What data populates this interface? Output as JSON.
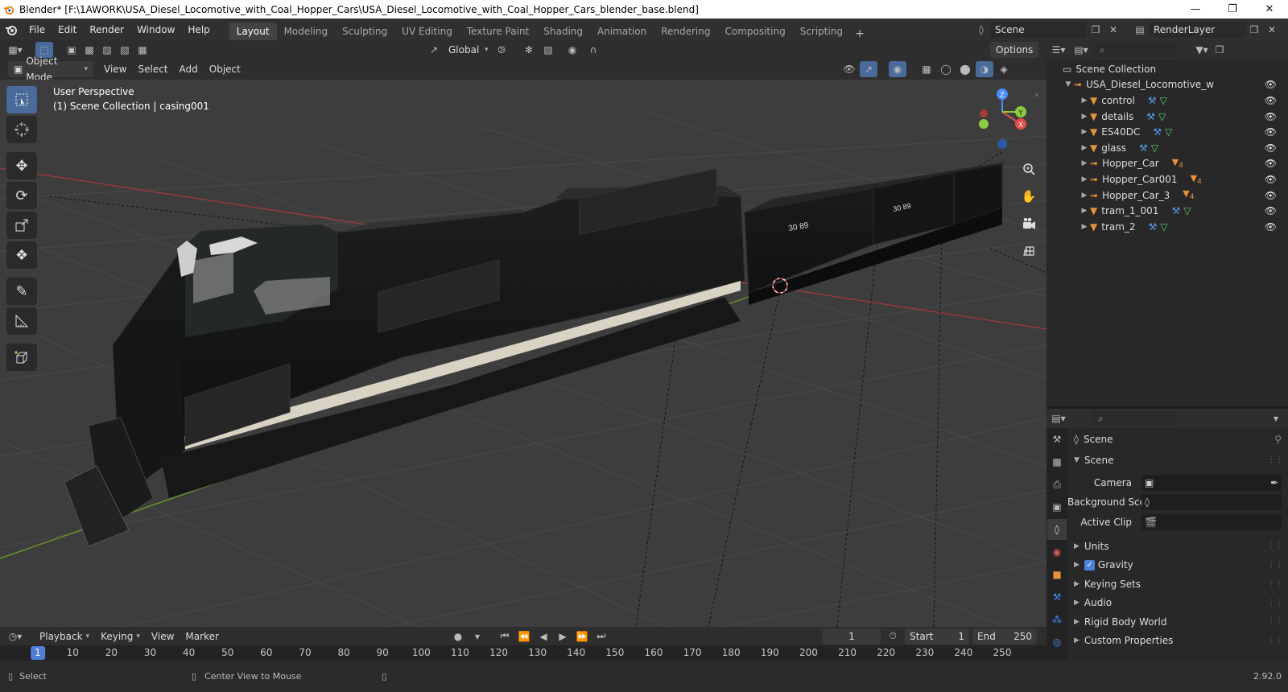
{
  "window": {
    "title": "Blender* [F:\\1AWORK\\USA_Diesel_Locomotive_with_Coal_Hopper_Cars\\USA_Diesel_Locomotive_with_Coal_Hopper_Cars_blender_base.blend]"
  },
  "menu": {
    "file": "File",
    "edit": "Edit",
    "render": "Render",
    "window": "Window",
    "help": "Help"
  },
  "workspaces": [
    "Layout",
    "Modeling",
    "Sculpting",
    "UV Editing",
    "Texture Paint",
    "Shading",
    "Animation",
    "Rendering",
    "Compositing",
    "Scripting"
  ],
  "active_workspace": "Layout",
  "scene_selector": {
    "value": "Scene"
  },
  "render_layer": {
    "value": "RenderLayer"
  },
  "viewport_header": {
    "transform_orientation": "Global",
    "options_label": "Options",
    "mode": "Object Mode",
    "view": "View",
    "select": "Select",
    "add": "Add",
    "object": "Object"
  },
  "viewport": {
    "perspective_label": "User Perspective",
    "collection_label": "(1) Scene Collection | casing001",
    "gizmo": {
      "x": "X",
      "y": "Y",
      "z": "Z"
    },
    "car_number": "30 89",
    "car_number_2": "30 89"
  },
  "outliner": {
    "root": "Scene Collection",
    "collection": "USA_Diesel_Locomotive_with_C",
    "items": [
      {
        "name": "control",
        "icon": "mesh"
      },
      {
        "name": "details",
        "icon": "mesh"
      },
      {
        "name": "ES40DC",
        "icon": "mesh"
      },
      {
        "name": "glass",
        "icon": "mesh"
      },
      {
        "name": "Hopper_Car",
        "icon": "empty",
        "badge": "4"
      },
      {
        "name": "Hopper_Car001",
        "icon": "empty",
        "badge": "4"
      },
      {
        "name": "Hopper_Car_3",
        "icon": "empty",
        "badge": "4"
      },
      {
        "name": "tram_1_001",
        "icon": "mesh"
      },
      {
        "name": "tram_2",
        "icon": "mesh"
      }
    ]
  },
  "properties": {
    "context": "Scene",
    "panel": "Scene",
    "camera_label": "Camera",
    "background_label": "Background Sce...",
    "active_clip_label": "Active Clip",
    "sections": [
      "Units",
      "Gravity",
      "Keying Sets",
      "Audio",
      "Rigid Body World",
      "Custom Properties"
    ],
    "gravity_checked": true
  },
  "timeline": {
    "playback": "Playback",
    "keying": "Keying",
    "view": "View",
    "marker": "Marker",
    "current_frame": "1",
    "start_label": "Start",
    "start_value": "1",
    "end_label": "End",
    "end_value": "250",
    "ruler": [
      "1",
      "10",
      "20",
      "30",
      "40",
      "50",
      "60",
      "70",
      "80",
      "90",
      "100",
      "110",
      "120",
      "130",
      "140",
      "150",
      "160",
      "170",
      "180",
      "190",
      "200",
      "210",
      "220",
      "230",
      "240",
      "250"
    ]
  },
  "status": {
    "select": "Select",
    "center": "Center View to Mouse",
    "version": "2.92.0"
  },
  "colors": {
    "accent": "#4d7fd6",
    "x_axis": "#e34d4d",
    "y_axis": "#8ccc40",
    "z_axis": "#4a8cff",
    "bg": "#3d3d3d"
  }
}
